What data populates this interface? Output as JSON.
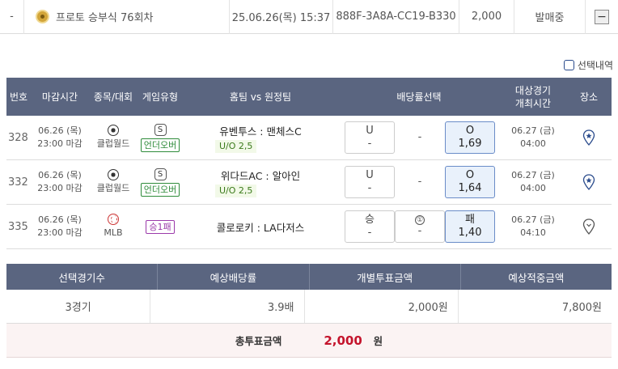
{
  "top": {
    "dash": "-",
    "title": "프로토 승부식 76회차",
    "datetime": "25.06.26(목) 15:37",
    "code": "888F-3A8A-CC19-B330",
    "amount": "2,000",
    "status": "발매중",
    "minus": "−"
  },
  "selection_label": "선택내역",
  "headers": {
    "no": "번호",
    "deadline": "마감시간",
    "sport": "종목/대회",
    "type": "게임유형",
    "teams": "홈팀 vs 원정팀",
    "odds": "배당률선택",
    "date_line1": "대상경기",
    "date_line2": "개최시간",
    "place": "장소"
  },
  "rows": [
    {
      "no": "328",
      "deadline_date": "06.26 (목)",
      "deadline_time": "23:00 마감",
      "league": "클럽월드",
      "badge": "S",
      "type": "언더오버",
      "teams": "유벤투스 : 맨체스C",
      "uo": "U/O 2,5",
      "opt1_label": "U",
      "opt1_val": "-",
      "mid": "-",
      "opt2_label": "O",
      "opt2_val": "1,69",
      "event_date": "06.27 (금)",
      "event_time": "04:00"
    },
    {
      "no": "332",
      "deadline_date": "06.26 (목)",
      "deadline_time": "23:00 마감",
      "league": "클럽월드",
      "badge": "S",
      "type": "언더오버",
      "teams": "위다드AC : 알아인",
      "uo": "U/O 2,5",
      "opt1_label": "U",
      "opt1_val": "-",
      "mid": "-",
      "opt2_label": "O",
      "opt2_val": "1,64",
      "event_date": "06.27 (금)",
      "event_time": "04:00"
    },
    {
      "no": "335",
      "deadline_date": "06.26 (목)",
      "deadline_time": "23:00 마감",
      "league": "MLB",
      "type": "승1패",
      "teams": "콜로로키 : LA다저스",
      "opt1_label": "승",
      "opt1_val": "-",
      "mid_label": "①",
      "mid": "-",
      "opt2_label": "패",
      "opt2_val": "1,40",
      "event_date": "06.27 (금)",
      "event_time": "04:10"
    }
  ],
  "summary": {
    "h1": "선택경기수",
    "h2": "예상배당률",
    "h3": "개별투표금액",
    "h4": "예상적중금액",
    "v1": "3경기",
    "v2": "3.9배",
    "v3": "2,000원",
    "v4": "7,800원",
    "total_label": "총투표금액",
    "total_value": "2,000",
    "total_unit": "원"
  },
  "colors": {
    "header_bg": "#5a6580",
    "accent_red": "#c4142c",
    "selected_bg": "#e9f1fb"
  }
}
